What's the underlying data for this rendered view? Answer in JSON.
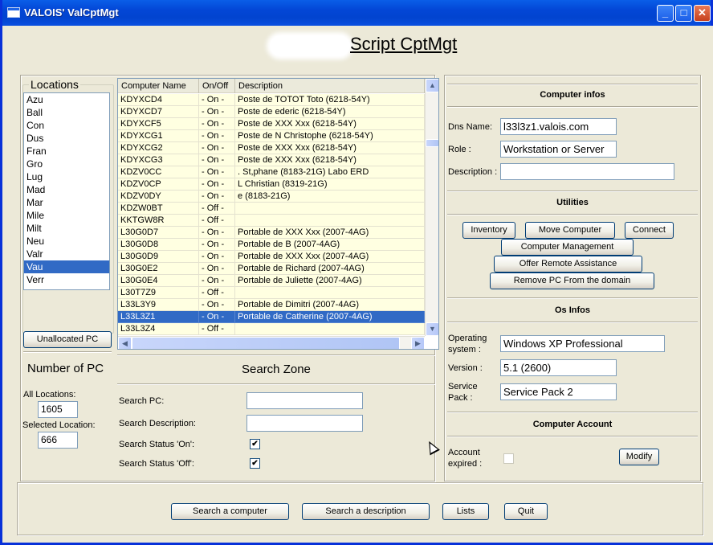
{
  "window": {
    "title": "VALOIS' ValCptMgt"
  },
  "header": {
    "title": " Script CptMgt"
  },
  "locations": {
    "legend": "Locations",
    "items": [
      "Azu",
      "Ball",
      "Con",
      "Dus",
      "Fran",
      "Gro",
      "Lug",
      "Mad",
      "Mar",
      "Mile",
      "Milt",
      "Neu",
      "Valr",
      "Vau",
      "Verr"
    ],
    "selected_index": 13,
    "unallocated_button": "Unallocated PC"
  },
  "counts": {
    "title": "Number of PC",
    "all_label": "All Locations:",
    "all_value": "1605",
    "selected_label": "Selected Location:",
    "selected_value": "666"
  },
  "grid": {
    "columns": [
      "Computer Name",
      "On/Off",
      "Description"
    ],
    "rows": [
      [
        "KDYXCD4",
        "- On -",
        "Poste de TOTOT Toto (6218-54Y)"
      ],
      [
        "KDYXCD7",
        "- On -",
        "Poste de ederic (6218-54Y)"
      ],
      [
        "KDYXCF5",
        "- On -",
        "Poste de XXX Xxx (6218-54Y)"
      ],
      [
        "KDYXCG1",
        "- On -",
        "Poste de N Christophe (6218-54Y)"
      ],
      [
        "KDYXCG2",
        "- On -",
        "Poste de XXX Xxx (6218-54Y)"
      ],
      [
        "KDYXCG3",
        "- On -",
        "Poste de XXX Xxx (6218-54Y)"
      ],
      [
        "KDZV0CC",
        "- On -",
        ". St,phane (8183-21G) Labo ERD"
      ],
      [
        "KDZV0CP",
        "- On -",
        "L Christian (8319-21G)"
      ],
      [
        "KDZV0DY",
        "- On -",
        "e (8183-21G)"
      ],
      [
        "KDZW0BT",
        "- Off -",
        ""
      ],
      [
        "KKTGW8R",
        "- Off -",
        ""
      ],
      [
        "L30G0D7",
        "- On -",
        "Portable de XXX Xxx (2007-4AG)"
      ],
      [
        "L30G0D8",
        "- On -",
        "Portable de B (2007-4AG)"
      ],
      [
        "L30G0D9",
        "- On -",
        "Portable de XXX Xxx (2007-4AG)"
      ],
      [
        "L30G0E2",
        "- On -",
        "Portable de Richard (2007-4AG)"
      ],
      [
        "L30G0E4",
        "- On -",
        "Portable de Juliette (2007-4AG)"
      ],
      [
        "L30T7Z9",
        "- Off -",
        ""
      ],
      [
        "L33L3Y9",
        "- On -",
        "Portable de Dimitri (2007-4AG)"
      ],
      [
        "L33L3Z1",
        "- On -",
        "Portable de Catherine (2007-4AG)"
      ],
      [
        "L33L3Z4",
        "- Off -",
        ""
      ]
    ],
    "selected_index": 18
  },
  "search": {
    "title": "Search Zone",
    "pc_label": "Search PC:",
    "pc_value": "",
    "desc_label": "Search Description:",
    "desc_value": "",
    "status_on_label": "Search Status 'On':",
    "status_off_label": "Search Status 'Off':",
    "check_mark": "✔"
  },
  "computer_infos": {
    "title": "Computer infos",
    "dns_label": "Dns Name:",
    "dns_value": "l33l3z1.valois.com",
    "role_label": "Role :",
    "role_value": "Workstation or Server",
    "desc_label": "Description :",
    "desc_value": ""
  },
  "utilities": {
    "title": "Utilities",
    "inventory": "Inventory",
    "move_computer": "Move Computer",
    "connect": "Connect",
    "computer_management": "Computer Management",
    "offer_remote_assistance": "Offer Remote Assistance",
    "remove_pc": "Remove PC From the domain"
  },
  "os_infos": {
    "title": "Os Infos",
    "os_label_1": "Operating",
    "os_label_2": "system :",
    "os_value": "Windows XP Professional",
    "version_label": "Version :",
    "version_value": "5.1 (2600)",
    "sp_label_1": "Service",
    "sp_label_2": "Pack :",
    "sp_value": "Service Pack 2"
  },
  "account": {
    "title": "Computer Account",
    "expired_label_1": "Account",
    "expired_label_2": "expired :",
    "modify_button": "Modify"
  },
  "footer": {
    "search_computer": "Search a computer",
    "search_description": "Search a description",
    "lists": "Lists",
    "quit": "Quit"
  }
}
